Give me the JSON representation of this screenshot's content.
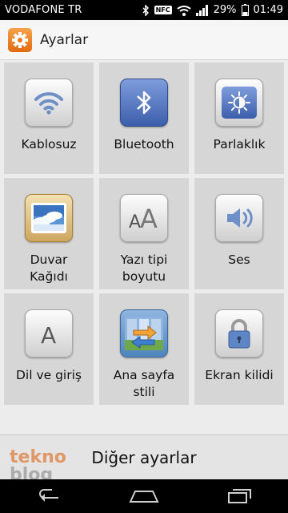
{
  "status_bar": {
    "carrier": "VODAFONE TR",
    "nfc": "NFC",
    "battery": "29%",
    "time": "01:49"
  },
  "header": {
    "title": "Ayarlar",
    "icon": "settings-gear-icon"
  },
  "tiles": [
    {
      "label": "Kablosuz",
      "icon": "wifi-icon"
    },
    {
      "label": "Bluetooth",
      "icon": "bluetooth-icon"
    },
    {
      "label": "Parlaklık",
      "icon": "brightness-icon"
    },
    {
      "label": "Duvar\nKağıdı",
      "icon": "wallpaper-icon"
    },
    {
      "label": "Yazı tipi\nboyutu",
      "icon": "font-size-icon"
    },
    {
      "label": "Ses",
      "icon": "speaker-icon"
    },
    {
      "label": "Dil ve giriş",
      "icon": "language-icon"
    },
    {
      "label": "Ana sayfa\nstili",
      "icon": "home-style-icon"
    },
    {
      "label": "Ekran kilidi",
      "icon": "lock-icon"
    }
  ],
  "footer": {
    "more_settings": "Diğer ayarlar",
    "watermark_top": "tekno",
    "watermark_bottom": "blog"
  },
  "nav": {
    "back": "back-icon",
    "home": "home-icon",
    "recents": "recents-icon"
  },
  "colors": {
    "tile_background": "#d6d6d6",
    "bluetooth_blue": "#4a6cb8",
    "app_icon_orange": "#f28a2a"
  }
}
